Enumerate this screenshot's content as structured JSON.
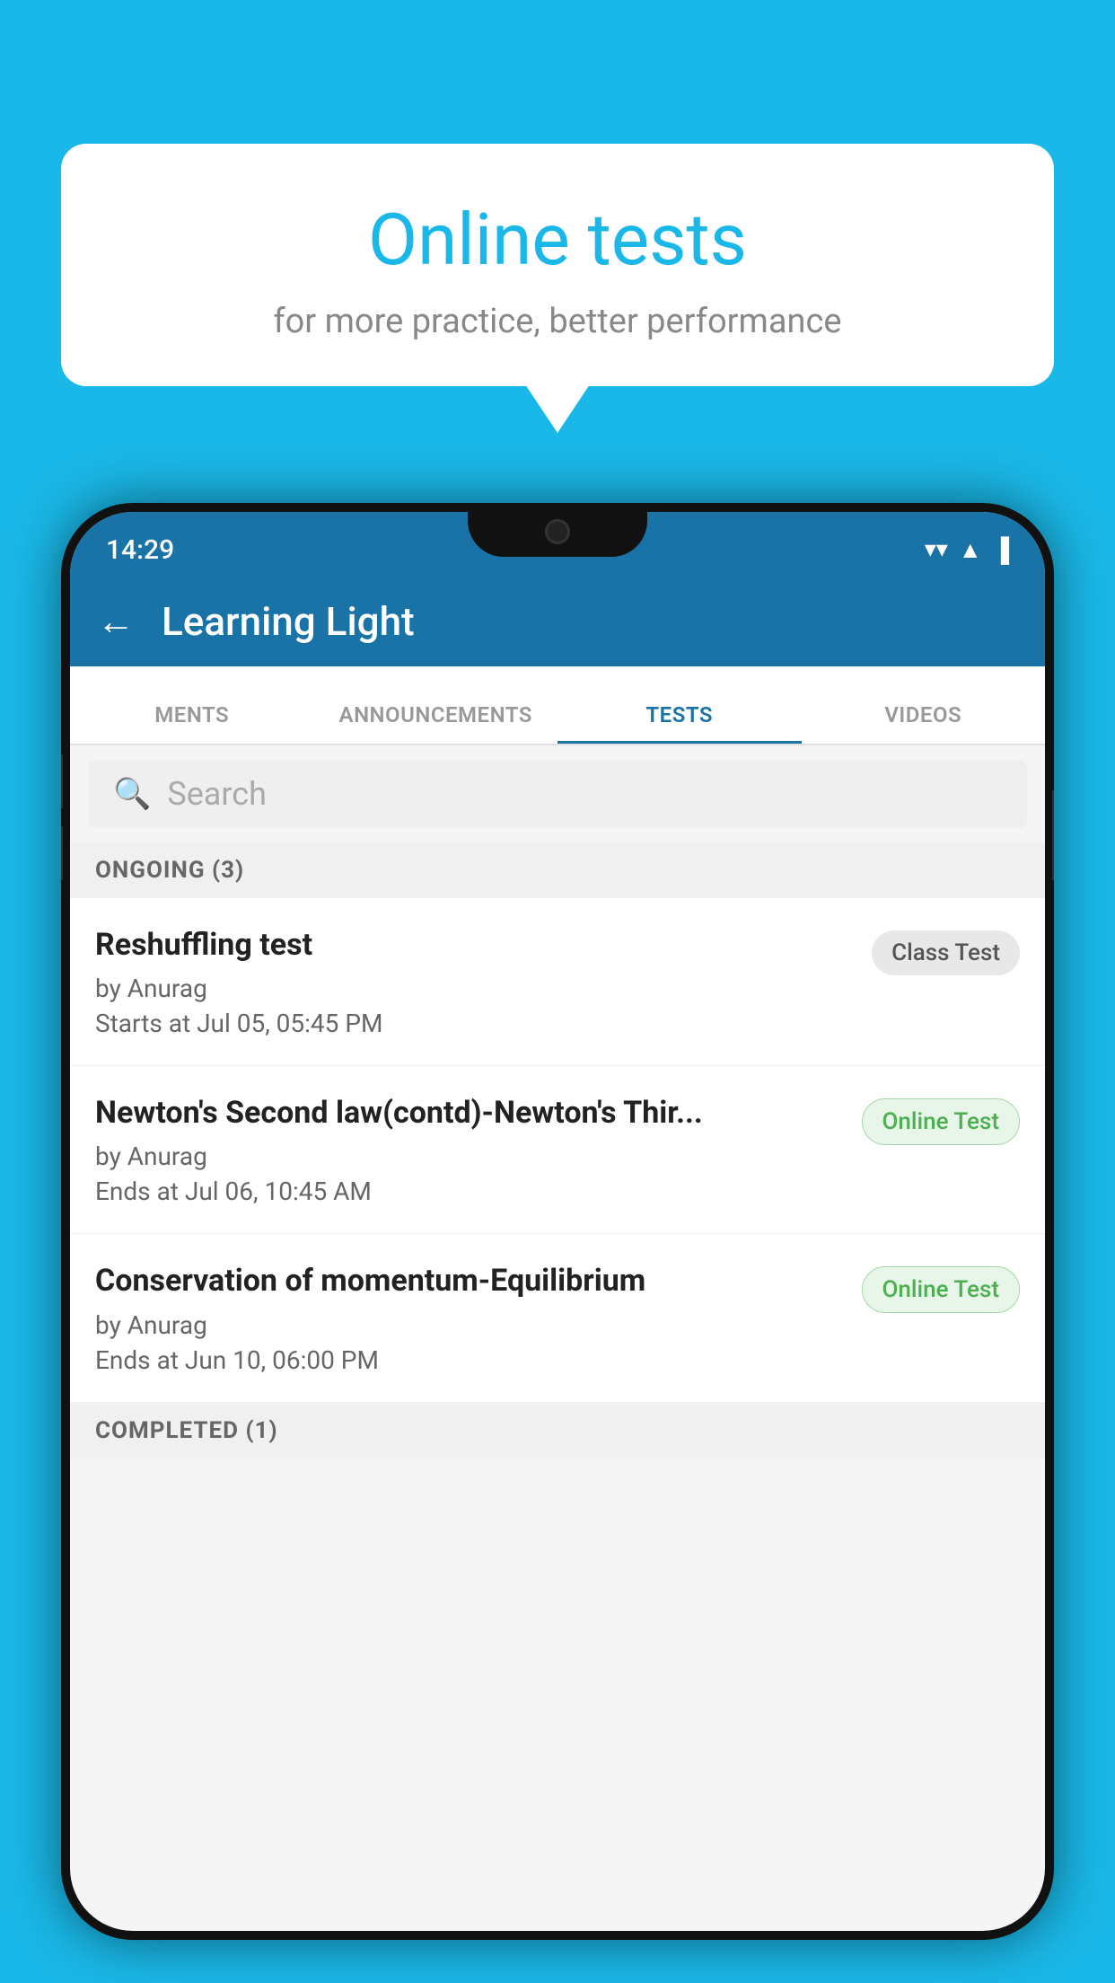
{
  "background_color": "#1ab8e8",
  "bubble": {
    "title": "Online tests",
    "subtitle": "for more practice, better performance"
  },
  "phone": {
    "status_bar": {
      "time": "14:29",
      "icons": [
        "wifi",
        "signal",
        "battery"
      ]
    },
    "app_bar": {
      "title": "Learning Light",
      "back_label": "←"
    },
    "tabs": [
      {
        "label": "MENTS",
        "active": false
      },
      {
        "label": "ANNOUNCEMENTS",
        "active": false
      },
      {
        "label": "TESTS",
        "active": true
      },
      {
        "label": "VIDEOS",
        "active": false
      }
    ],
    "search": {
      "placeholder": "Search"
    },
    "ongoing_section": {
      "header": "ONGOING (3)",
      "tests": [
        {
          "name": "Reshuffling test",
          "author": "by Anurag",
          "time": "Starts at  Jul 05, 05:45 PM",
          "badge": "Class Test",
          "badge_type": "class"
        },
        {
          "name": "Newton's Second law(contd)-Newton's Thir...",
          "author": "by Anurag",
          "time": "Ends at  Jul 06, 10:45 AM",
          "badge": "Online Test",
          "badge_type": "online"
        },
        {
          "name": "Conservation of momentum-Equilibrium",
          "author": "by Anurag",
          "time": "Ends at  Jun 10, 06:00 PM",
          "badge": "Online Test",
          "badge_type": "online"
        }
      ]
    },
    "completed_section": {
      "header": "COMPLETED (1)"
    }
  }
}
